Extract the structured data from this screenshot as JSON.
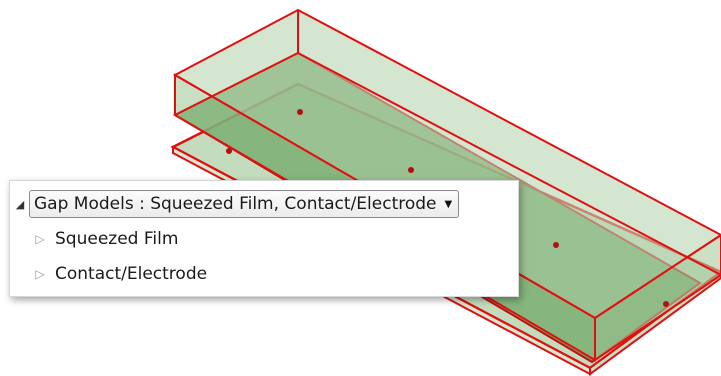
{
  "tree": {
    "root": {
      "expander_icon": "triangle-expanded-icon",
      "label": "Gap Models : Squeezed Film, Contact/Electrode",
      "dropdown_icon": "chevron-down-icon"
    },
    "children": [
      {
        "expander_icon": "triangle-collapsed-icon",
        "label": "Squeezed Film"
      },
      {
        "expander_icon": "triangle-collapsed-icon",
        "label": "Contact/Electrode"
      }
    ]
  },
  "geometry": {
    "name": "3d-gap-model",
    "face_color": "#5a9a4f",
    "edge_color": "#e01010",
    "dot_color": "#b01010"
  }
}
